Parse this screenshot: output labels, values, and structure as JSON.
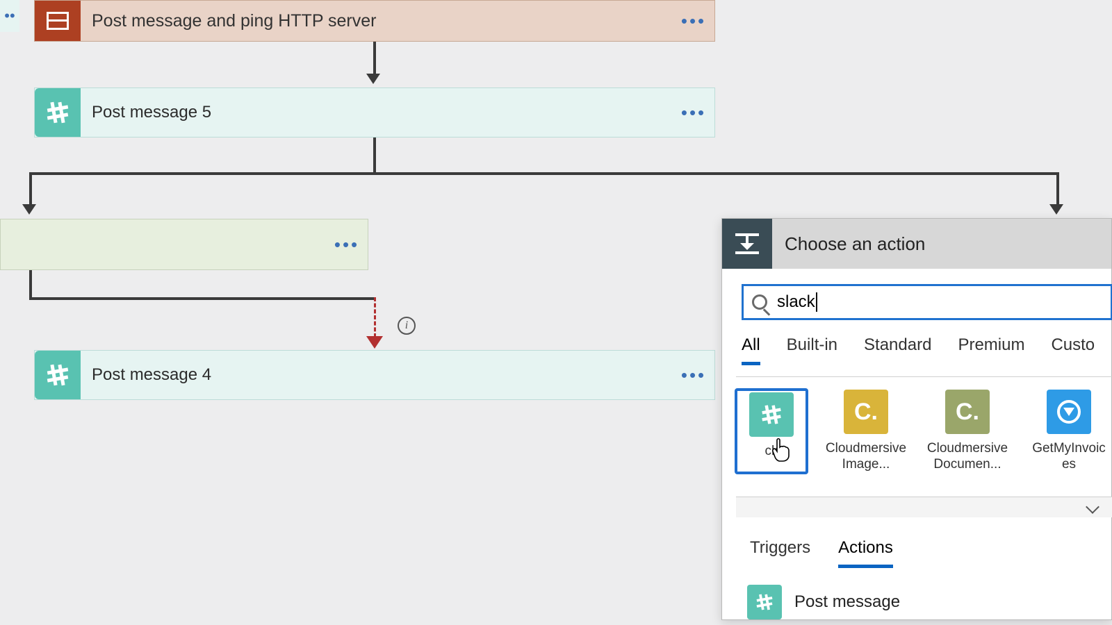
{
  "flow": {
    "scope": {
      "title": "Post message and ping HTTP server"
    },
    "msg5": {
      "title": "Post message 5"
    },
    "branch_left": {
      "title": ""
    },
    "msg4": {
      "title": "Post message 4"
    }
  },
  "panel": {
    "header": "Choose an action",
    "search_value": "slack",
    "category_tabs": [
      "All",
      "Built-in",
      "Standard",
      "Premium",
      "Custo"
    ],
    "category_active": "All",
    "connectors": [
      {
        "name": "Slack",
        "label_visible": "ck",
        "tile": "slack"
      },
      {
        "name": "Cloudmersive Image...",
        "label_visible": "Cloudmersive Image...",
        "tile": "cm1",
        "glyph": "C."
      },
      {
        "name": "Cloudmersive Documen...",
        "label_visible": "Cloudmersive Documen...",
        "tile": "cm2",
        "glyph": "C."
      },
      {
        "name": "GetMyInvoices",
        "label_visible": "GetMyInvoic es",
        "tile": "gmi"
      }
    ],
    "selected_connector": "Slack",
    "ta_tabs": [
      "Triggers",
      "Actions"
    ],
    "ta_active": "Actions",
    "results": [
      {
        "label": "Post message",
        "tile": "slack"
      }
    ]
  },
  "colors": {
    "accent": "#0a64c2",
    "slack": "#59c2b1",
    "scope": "#ad4022"
  }
}
